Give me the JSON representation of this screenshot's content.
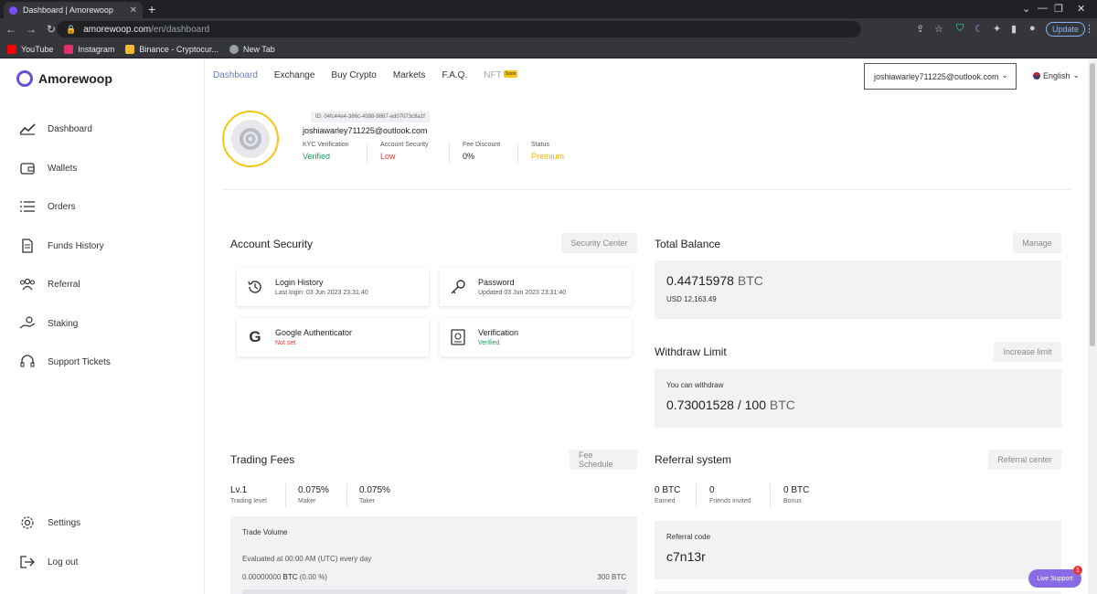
{
  "browser": {
    "tab_title": "Dashboard | Amorewoop",
    "url_host": "amorewoop.com",
    "url_path": "/en/dashboard",
    "update_label": "Update",
    "bookmarks": [
      {
        "label": "YouTube",
        "color": "#ff0000"
      },
      {
        "label": "Instagram",
        "color": "#e1306c"
      },
      {
        "label": "Binance - Cryptocur...",
        "color": "#f3ba2f"
      },
      {
        "label": "New Tab",
        "color": "#9aa0a6"
      }
    ]
  },
  "brand": {
    "name": "Amorewoop",
    "accent": "#6a4fd6"
  },
  "sidebar": {
    "items": [
      {
        "label": "Dashboard",
        "icon": "chart-icon"
      },
      {
        "label": "Wallets",
        "icon": "wallet-icon"
      },
      {
        "label": "Orders",
        "icon": "list-icon"
      },
      {
        "label": "Funds History",
        "icon": "document-icon"
      },
      {
        "label": "Referral",
        "icon": "users-icon"
      },
      {
        "label": "Staking",
        "icon": "hand-coin-icon"
      },
      {
        "label": "Support Tickets",
        "icon": "headset-icon"
      }
    ],
    "bottom_items": [
      {
        "label": "Settings",
        "icon": "gear-icon"
      },
      {
        "label": "Log out",
        "icon": "logout-icon"
      }
    ]
  },
  "topnav": {
    "items": [
      "Dashboard",
      "Exchange",
      "Buy Crypto",
      "Markets",
      "F.A.Q.",
      "NFT"
    ],
    "soon_badge": "Soon",
    "account_email": "joshiawarley711225@outlook.com",
    "language": "English"
  },
  "profile": {
    "id_label": "ID: 04fc44e4-386c-4098-9867-ed07073c8a1f",
    "email": "joshiawarley711225@outlook.com",
    "stats": [
      {
        "label": "KYC Verification",
        "value": "Verified",
        "color": "#1a9e5c"
      },
      {
        "label": "Account Security",
        "value": "Low",
        "color": "#e53935"
      },
      {
        "label": "Fee Discount",
        "value": "0%",
        "color": "#222222"
      },
      {
        "label": "Status",
        "value": "Premium",
        "color": "#f5b400"
      }
    ]
  },
  "account_security": {
    "title": "Account Security",
    "button": "Security Center",
    "cards": [
      {
        "title": "Login History",
        "sub": "Last login: 03 Jun 2023 23:31:40",
        "sub_color": "#555555",
        "icon": "history-icon"
      },
      {
        "title": "Password",
        "sub": "Updated 03 Jun 2023 23:31:40",
        "sub_color": "#555555",
        "icon": "key-icon"
      },
      {
        "title": "Google Authenticator",
        "sub": "Not set",
        "sub_color": "#e53935",
        "icon": "google-icon"
      },
      {
        "title": "Verification",
        "sub": "Verified",
        "sub_color": "#1a9e5c",
        "icon": "passport-icon"
      }
    ]
  },
  "total_balance": {
    "title": "Total Balance",
    "button": "Manage",
    "amount": "0.44715978",
    "unit": "BTC",
    "usd": "USD 12,163.49"
  },
  "withdraw": {
    "title": "Withdraw Limit",
    "button": "Increase limit",
    "label": "You can withdraw",
    "amount": "0.73001528 / 100",
    "unit": "BTC"
  },
  "trading_fees": {
    "title": "Trading Fees",
    "button": "Fee Schedule",
    "stats": [
      {
        "value": "Lv.1",
        "label": "Trading level"
      },
      {
        "value": "0.075%",
        "label": "Maker"
      },
      {
        "value": "0.075%",
        "label": "Taker"
      }
    ],
    "volume_title": "Trade Volume",
    "volume_note": "Evaluated at 00:00 AM (UTC) every day",
    "volume_current": "0.00000000",
    "volume_unit": "BTC",
    "volume_pct": "(0.00 %)",
    "volume_target": "300 BTC"
  },
  "referral": {
    "title": "Referral system",
    "button": "Referral center",
    "stats": [
      {
        "value": "0 BTC",
        "label": "Earned"
      },
      {
        "value": "0",
        "label": "Friends invited"
      },
      {
        "value": "0 BTC",
        "label": "Bonus"
      }
    ],
    "code_label": "Referral code",
    "code": "c7n13r"
  },
  "live_support": {
    "label": "Live Support",
    "badge": "1"
  }
}
